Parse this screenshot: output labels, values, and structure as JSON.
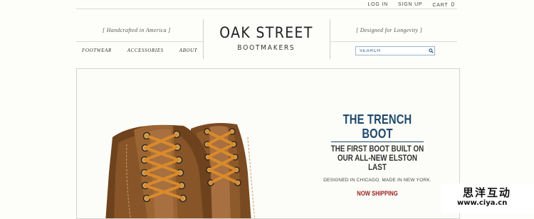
{
  "top_links": {
    "login": "LOG IN",
    "signup": "SIGN UP",
    "cart": "CART",
    "cart_count": "0"
  },
  "header": {
    "tagline_left": "[   Handcrafted in America   ]",
    "tagline_right": "[   Designed for Longevity   ]",
    "logo_main": "OAK STREET",
    "logo_sub": "BOOTMAKERS"
  },
  "nav": {
    "items": [
      "FOOTWEAR",
      "ACCESSORIES",
      "ABOUT"
    ]
  },
  "search": {
    "placeholder": "SEARCH",
    "icon": "search-icon"
  },
  "hero": {
    "title": "THE TRENCH BOOT",
    "subtitle_1": "THE FIRST BOOT BUILT ON",
    "subtitle_2": "OUR ALL-NEW ELSTON LAST",
    "small": "DESIGNED IN CHICAGO. MADE IN NEW YORK.",
    "cta": "NOW SHIPPING"
  },
  "watermark": {
    "big": "思洋互动",
    "small": "www.ciya.cn"
  },
  "colors": {
    "accent": "#1f4a6d",
    "cta": "#9a2020",
    "search_border": "#9bb5cf"
  }
}
